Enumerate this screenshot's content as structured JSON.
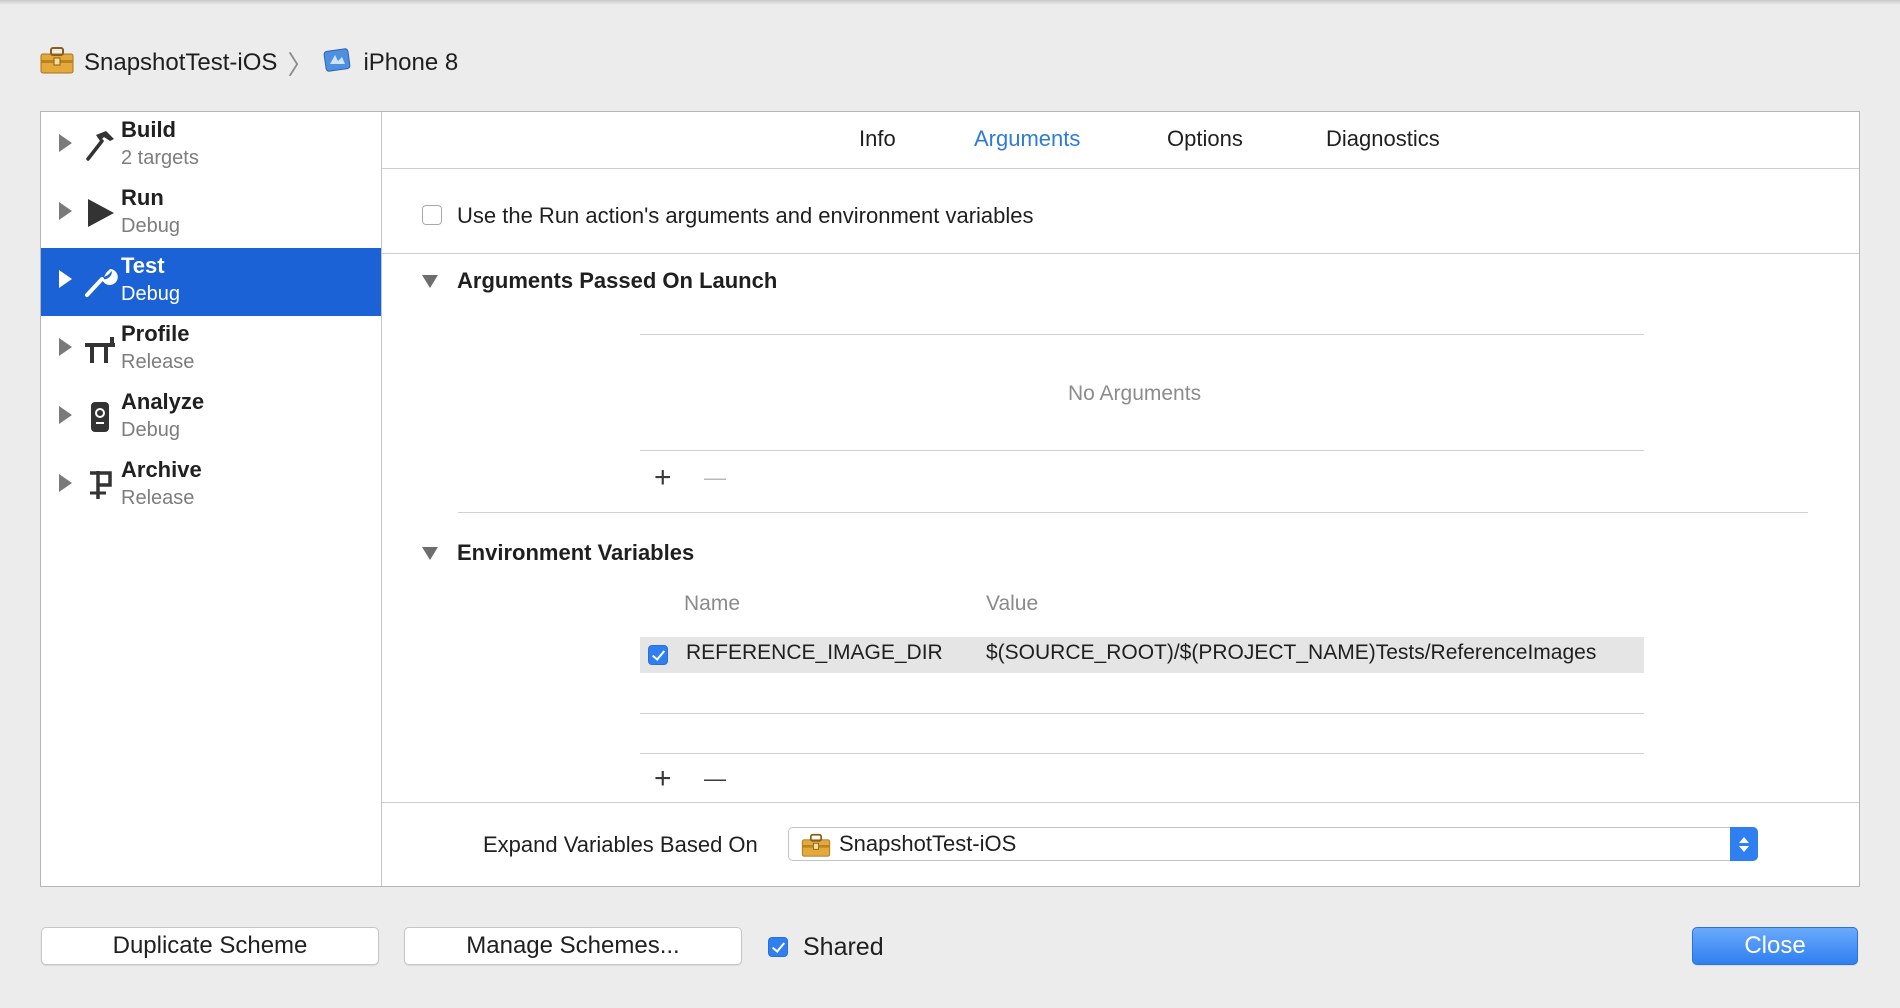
{
  "breadcrumb": {
    "project": "SnapshotTest-iOS",
    "separator": "〉",
    "device": "iPhone 8",
    "project_icon": "toolbox-icon",
    "device_icon": "xcode-device-icon"
  },
  "sidebar": {
    "items": [
      {
        "title": "Build",
        "subtitle": "2 targets",
        "icon": "hammer-icon"
      },
      {
        "title": "Run",
        "subtitle": "Debug",
        "icon": "play-icon"
      },
      {
        "title": "Test",
        "subtitle": "Debug",
        "icon": "wrench-icon",
        "selected": true
      },
      {
        "title": "Profile",
        "subtitle": "Release",
        "icon": "instruments-icon"
      },
      {
        "title": "Analyze",
        "subtitle": "Debug",
        "icon": "analyze-icon"
      },
      {
        "title": "Archive",
        "subtitle": "Release",
        "icon": "archive-icon"
      }
    ]
  },
  "tabs": [
    {
      "label": "Info",
      "active": false
    },
    {
      "label": "Arguments",
      "active": true
    },
    {
      "label": "Options",
      "active": false
    },
    {
      "label": "Diagnostics",
      "active": false
    }
  ],
  "use_run_action": {
    "label": "Use the Run action's arguments and environment variables",
    "checked": false
  },
  "arguments": {
    "title": "Arguments Passed On Launch",
    "empty_text": "No Arguments",
    "add": "+",
    "remove": "—"
  },
  "environment": {
    "title": "Environment Variables",
    "columns": {
      "name": "Name",
      "value": "Value"
    },
    "rows": [
      {
        "enabled": true,
        "name": "REFERENCE_IMAGE_DIR",
        "value": "$(SOURCE_ROOT)/$(PROJECT_NAME)Tests/ReferenceImages"
      }
    ],
    "add": "+",
    "remove": "—"
  },
  "expand_variables": {
    "label": "Expand Variables Based On",
    "value": "SnapshotTest-iOS"
  },
  "footer": {
    "duplicate": "Duplicate Scheme",
    "manage": "Manage Schemes...",
    "shared_label": "Shared",
    "shared_checked": true,
    "close": "Close"
  },
  "colors": {
    "accent": "#2e7cd6",
    "selection": "#1b62d6"
  }
}
